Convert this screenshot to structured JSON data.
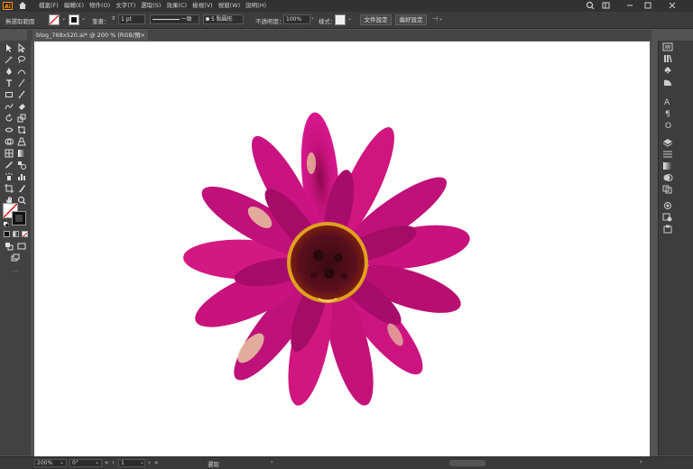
{
  "app": {
    "logo_text": "Ai"
  },
  "menubar": {
    "items": [
      "檔案(F)",
      "編輯(E)",
      "物件(O)",
      "文字(T)",
      "選取(S)",
      "效果(C)",
      "檢視(V)",
      "視窗(W)",
      "說明(H)"
    ]
  },
  "controlbar": {
    "selection_label": "無選取範圍",
    "stroke_label": "筆畫：",
    "stroke_weight": "1 pt",
    "stroke_style": "一致",
    "brush": "5 點圓形",
    "opacity_label": "不透明度：",
    "opacity_value": "100%",
    "style_label": "樣式：",
    "doc_setup_button": "文件設定",
    "preferences_button": "偏好設定"
  },
  "document": {
    "tab_title": "blog_768x520.ai* @ 200 % (RGB/預視)",
    "close_glyph": "×"
  },
  "statusbar": {
    "zoom": "200%",
    "rotation": "0°",
    "artboard_number": "1",
    "tool_name": "選取"
  },
  "colors": {
    "accent_logo": "#ff9a00",
    "flower_petal": "#c4127a",
    "flower_center": "#5a0f1e"
  },
  "icons": [
    "home-icon",
    "search-icon",
    "arrange-icon",
    "window-min-icon",
    "window-max-icon",
    "window-close-icon"
  ]
}
